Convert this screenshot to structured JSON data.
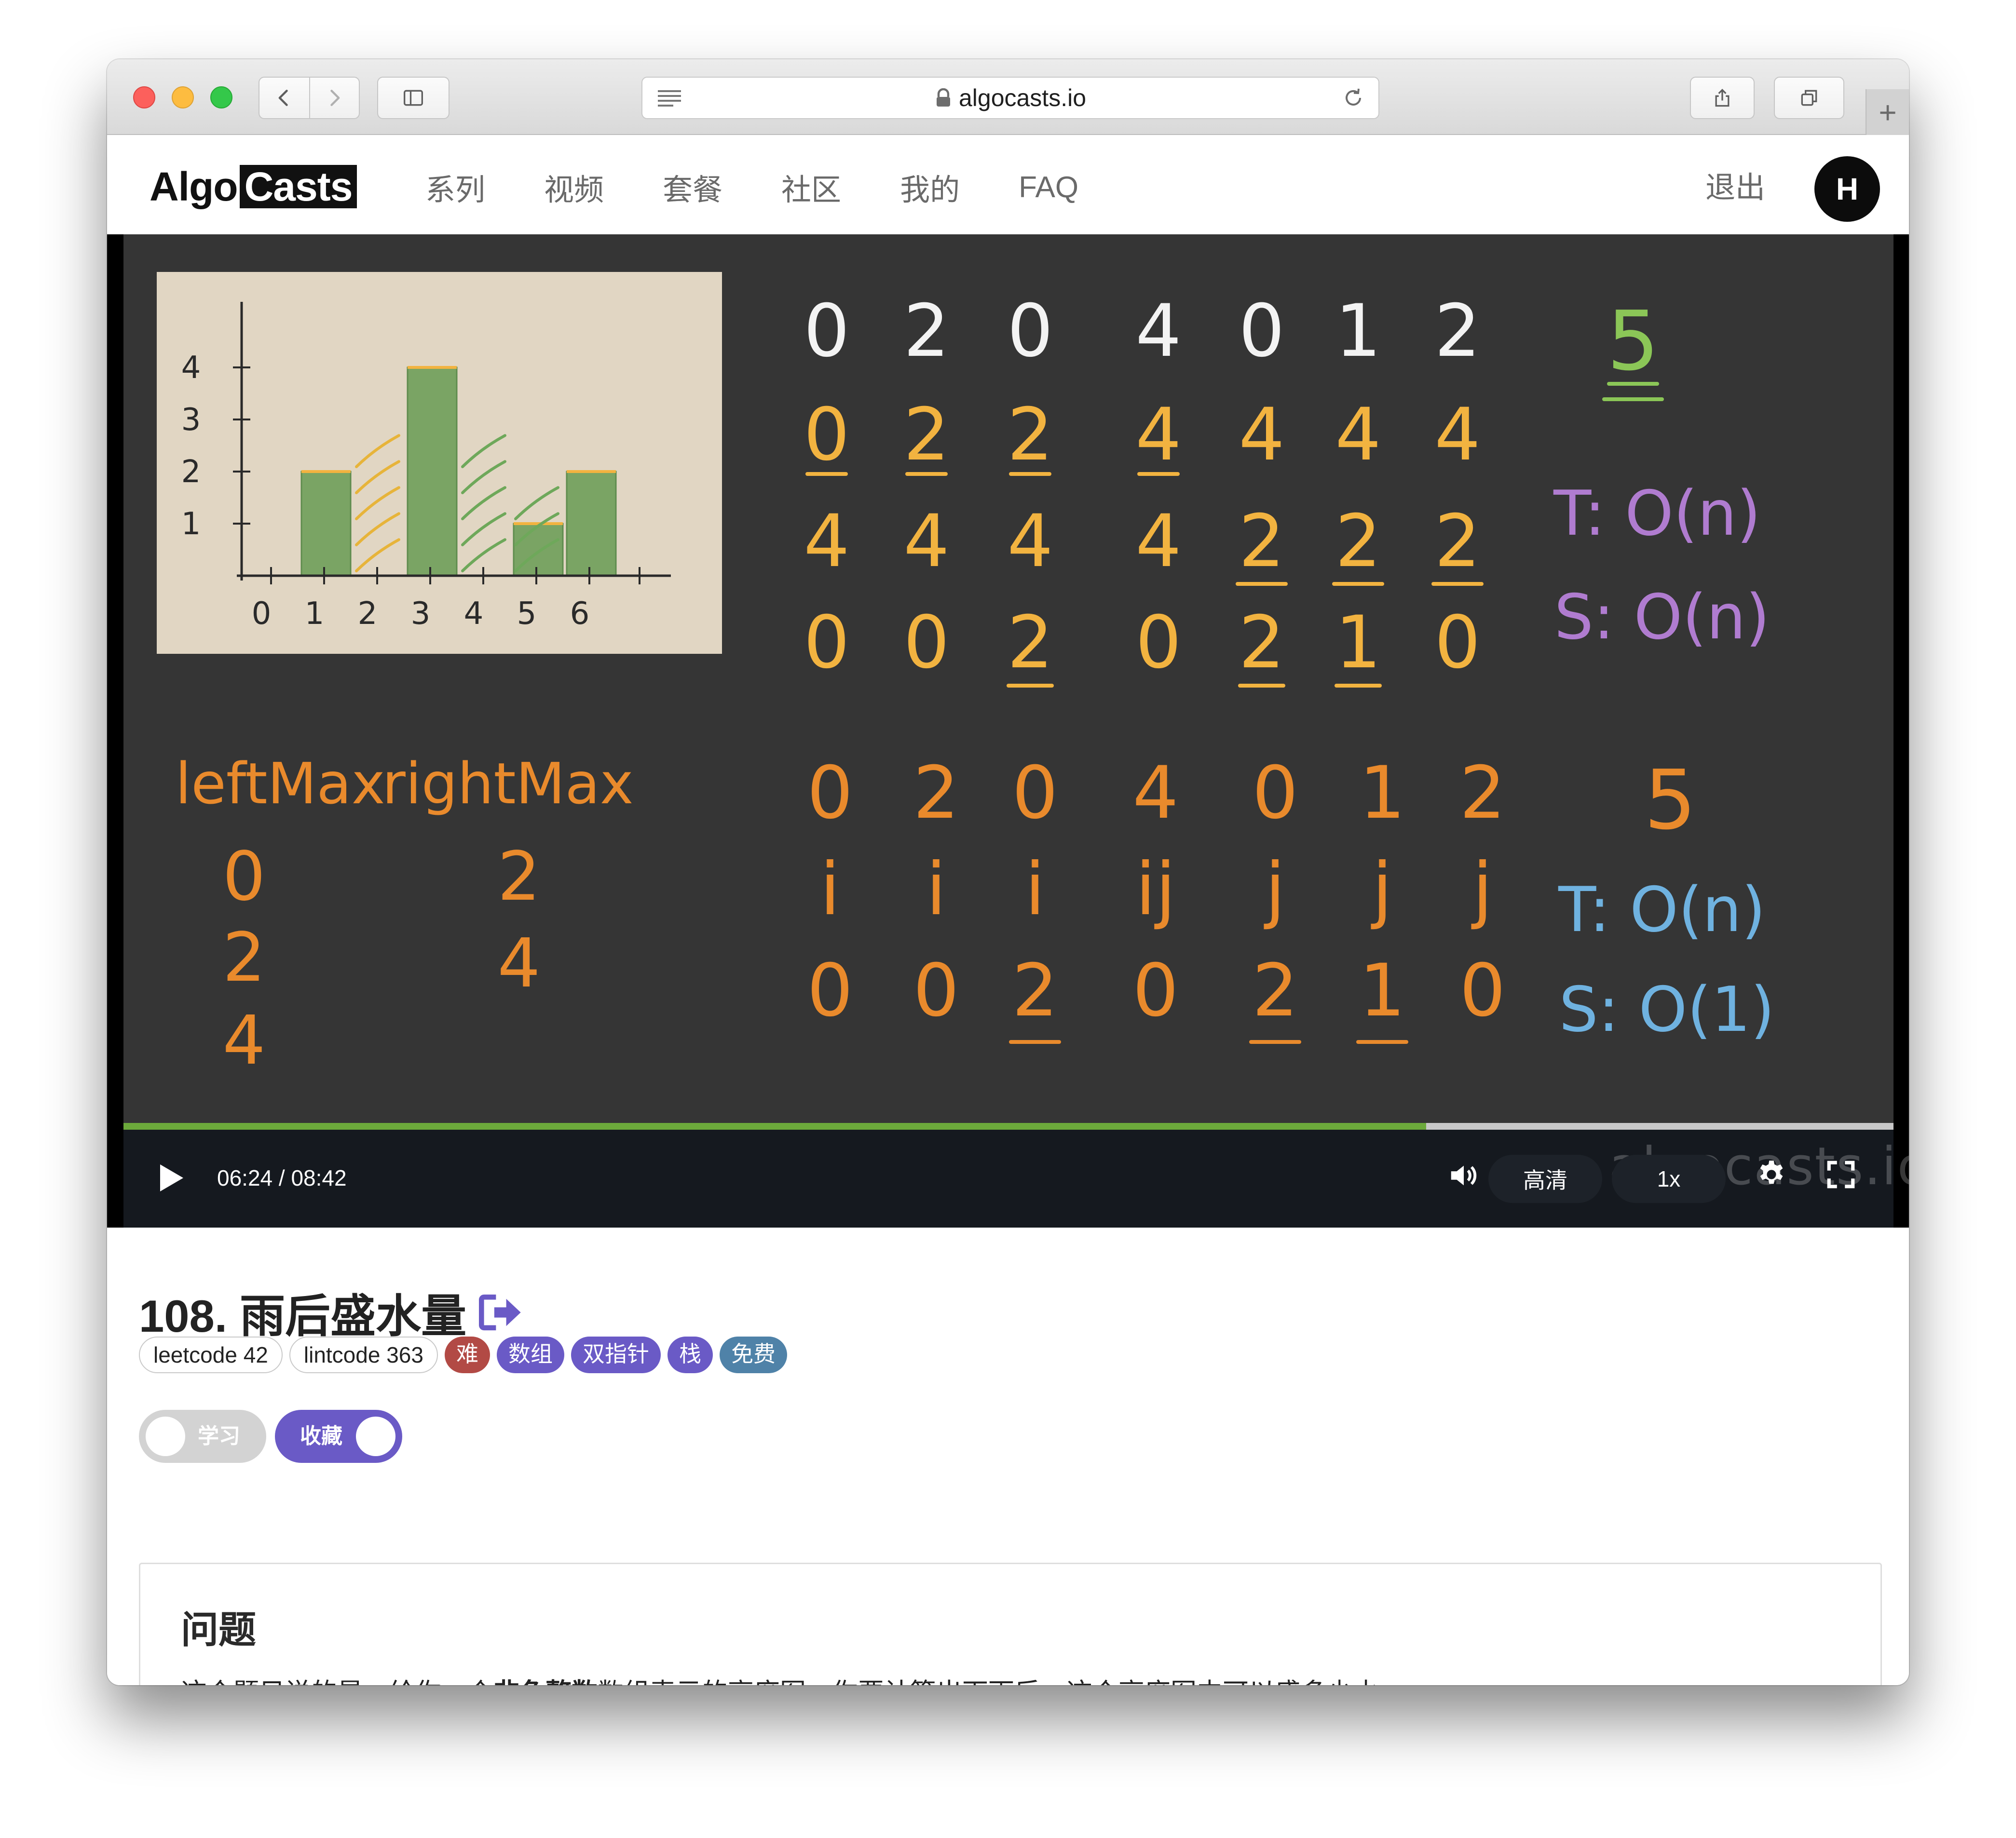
{
  "browser": {
    "url": "algocasts.io",
    "newtab_label": "+"
  },
  "site": {
    "logo_left": "Algo",
    "logo_right": "Casts",
    "nav": [
      "系列",
      "视频",
      "套餐",
      "社区",
      "我的",
      "FAQ"
    ],
    "logout": "退出",
    "avatar_letter": "H"
  },
  "video": {
    "time": "06:24 / 08:42",
    "progress": 0.736,
    "quality": "高清",
    "speed": "1x",
    "watermark": "algocasts.io",
    "colors": {
      "progress": "#6ca93b",
      "controls_bg": "#15191f",
      "board": "#353535"
    }
  },
  "lesson": {
    "title": "108. 雨后盛水量",
    "tags": [
      {
        "label": "leetcode 42",
        "style": "outline"
      },
      {
        "label": "lintcode 363",
        "style": "outline"
      },
      {
        "label": "难",
        "style": "solid",
        "color": "#b24a45"
      },
      {
        "label": "数组",
        "style": "solid",
        "color": "#6a5ac6"
      },
      {
        "label": "双指针",
        "style": "solid",
        "color": "#6a5ac6"
      },
      {
        "label": "栈",
        "style": "solid",
        "color": "#6a5ac6"
      },
      {
        "label": "免费",
        "style": "solid",
        "color": "#4f82a8"
      }
    ],
    "toggle_learn": "学习",
    "toggle_learn_on": false,
    "toggle_fav": "收藏",
    "toggle_fav_on": true
  },
  "problem": {
    "heading": "问题",
    "text_before": "这个题目说的是，给你一个",
    "text_bold": "非负整数",
    "text_after": "数组表示的高度图，你要计算出下雨后，这个高度图中可以盛多少水。"
  },
  "board": {
    "heights": [
      0,
      2,
      0,
      4,
      0,
      1,
      2
    ],
    "left_max": [
      0,
      2,
      2,
      4,
      4,
      4,
      4
    ],
    "right_max": [
      4,
      4,
      4,
      4,
      2,
      2,
      2
    ],
    "water": [
      0,
      0,
      2,
      0,
      2,
      1,
      0
    ],
    "total": "5",
    "complexity_1": [
      "T: O(n)",
      "S: O(n)"
    ],
    "vars_labels": [
      "leftMax",
      "rightMax"
    ],
    "left_vals": [
      "0",
      "2",
      "4"
    ],
    "right_vals": [
      "2",
      "4"
    ],
    "pointers": [
      "i",
      "i",
      "i",
      "ij",
      "j",
      "j",
      "j"
    ],
    "complexity_2": [
      "T: O(n)",
      "S: O(1)"
    ],
    "chart_y_ticks": [
      "4",
      "3",
      "2",
      "1"
    ],
    "chart_x_ticks": [
      "0",
      "1",
      "2",
      "3",
      "4",
      "5",
      "6"
    ]
  }
}
